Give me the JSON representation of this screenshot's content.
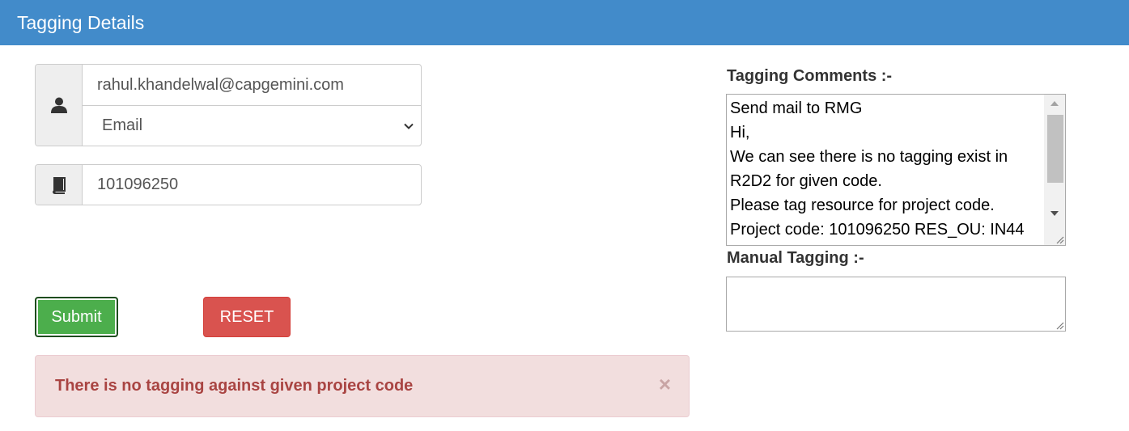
{
  "header": {
    "title": "Tagging Details"
  },
  "form": {
    "email_value": "rahul.khandelwal@capgemini.com",
    "search_type_selected": "Email",
    "project_code_value": "101096250",
    "submit_label": "Submit",
    "reset_label": "RESET"
  },
  "alert": {
    "message": "There is no tagging against given project code",
    "close_symbol": "×"
  },
  "tagging_comments": {
    "label": "Tagging Comments :-",
    "lines": [
      "Send mail to RMG",
      "Hi,",
      "We can see there is no tagging exist in",
      "R2D2 for given code.",
      "Please tag resource for project code.",
      "Project code: 101096250 RES_OU: IN44"
    ]
  },
  "manual_tagging": {
    "label": "Manual Tagging :-",
    "value": ""
  },
  "colors": {
    "header": "#428bca",
    "submit": "#4cae4c",
    "reset": "#d9534f",
    "alert_bg": "#f2dede",
    "alert_text": "#a94442"
  },
  "icons": {
    "user_addon": "user-icon",
    "project_addon": "book-icon"
  }
}
